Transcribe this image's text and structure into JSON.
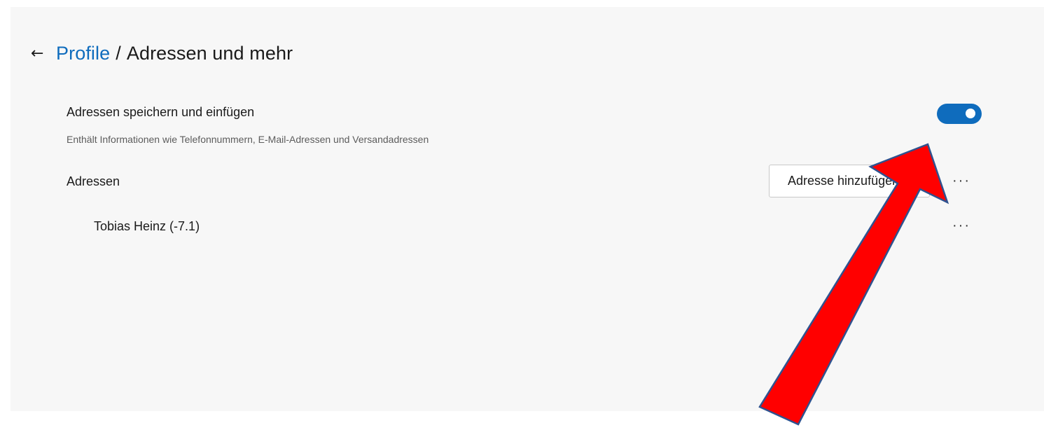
{
  "header": {
    "back_icon": "back-arrow-icon",
    "breadcrumb_parent": "Profile",
    "breadcrumb_separator": "/",
    "breadcrumb_current": "Adressen und mehr"
  },
  "setting": {
    "title": "Adressen speichern und einfügen",
    "description": "Enthält Informationen wie Telefonnummern, E-Mail-Adressen und Versandadressen",
    "toggle_on": true,
    "toggle_color": "#0f6cbd"
  },
  "addresses": {
    "label": "Adressen",
    "add_button_label": "Adresse hinzufügen",
    "more_label": "···",
    "entries": [
      {
        "name": "Tobias Heinz (-7.1)",
        "more_label": "···"
      }
    ]
  },
  "annotation": {
    "arrow_color": "#ff0000",
    "arrow_outline": "#2f528f",
    "icon": "red-arrow-icon"
  }
}
